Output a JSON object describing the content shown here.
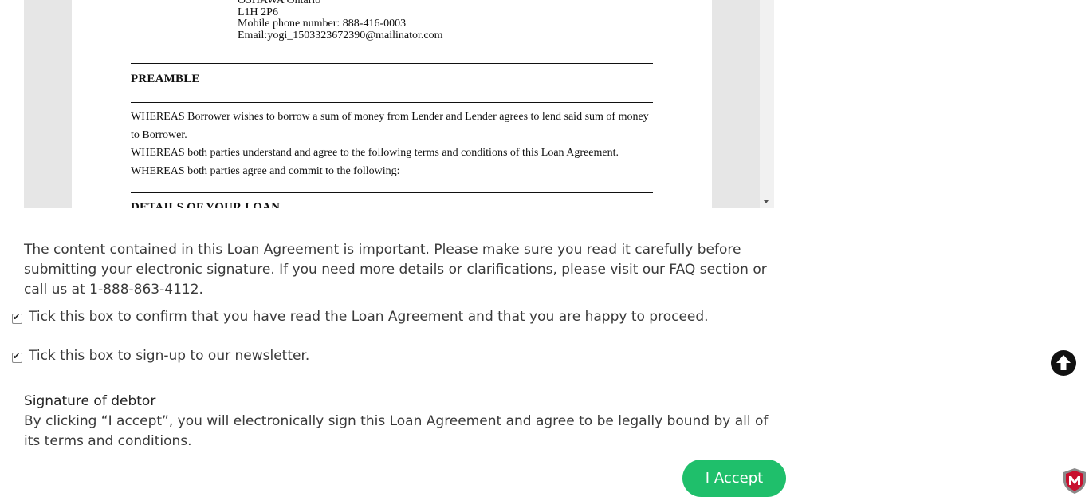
{
  "agreement": {
    "address_lines": [
      "OSHAWA Ontario",
      "L1H 2P6",
      "Mobile phone number: 888-416-0003",
      "Email:yogi_1503323672390@mailinator.com"
    ],
    "preamble_heading": "PREAMBLE",
    "preamble_lines": [
      "WHEREAS Borrower wishes to borrow a sum of money from Lender and Lender agrees to lend said sum of money to Borrower.",
      "WHEREAS both parties understand and agree to the following terms and conditions of this Loan Agreement.",
      "WHEREAS both parties agree and commit to the following:"
    ],
    "next_heading": "DETAILS OF YOUR LOAN"
  },
  "notice": "The content contained in this Loan Agreement is important. Please make sure you read it carefully before submitting your electronic signature. If you need more details or clarifications, please visit our FAQ section or call us at 1-888-863-4112.",
  "checkboxes": [
    {
      "label": "Tick this box to confirm that you have read the Loan Agreement and that you are happy to proceed.",
      "checked": true
    },
    {
      "label": "Tick this box to sign-up to our newsletter.",
      "checked": true
    }
  ],
  "signature": {
    "title": "Signature of debtor",
    "text": "By clicking “I accept”, you will electronically sign this Loan Agreement and agree to be legally bound by all of its terms and conditions."
  },
  "accept_button": "I Accept",
  "icons": {
    "scroll_top": "arrow-up-circle-icon",
    "security_badge": "mcafee-shield-icon"
  },
  "colors": {
    "accept_green": "#1fbf6b",
    "text": "#3a3a3a"
  }
}
